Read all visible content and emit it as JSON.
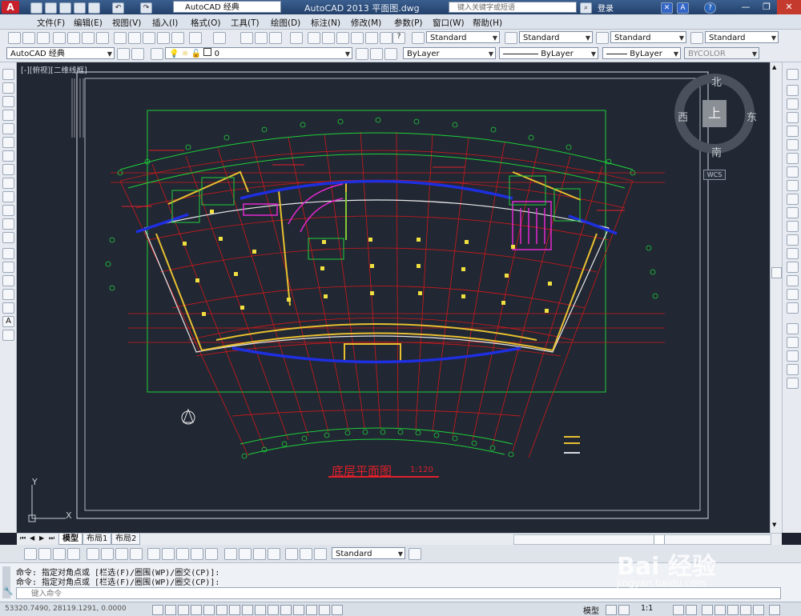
{
  "titlebar": {
    "workspace": "AutoCAD 经典",
    "app_title": "AutoCAD 2013    平面图.dwg",
    "search_placeholder": "键入关键字或短语",
    "login": "登录"
  },
  "menu": [
    "文件(F)",
    "编辑(E)",
    "视图(V)",
    "插入(I)",
    "格式(O)",
    "工具(T)",
    "绘图(D)",
    "标注(N)",
    "修改(M)",
    "参数(P)",
    "窗口(W)",
    "帮助(H)"
  ],
  "styles": {
    "text_style": "Standard",
    "dim_style": "Standard",
    "table_style": "Standard",
    "mleader_style": "Standard"
  },
  "layers": {
    "workspace": "AutoCAD 经典",
    "current_layer": "0",
    "color": "ByLayer",
    "linetype": "ByLayer",
    "lineweight": "ByLayer",
    "plotstyle": "BYCOLOR"
  },
  "viewport_label": "[-][俯视][二维线框]",
  "viewcube": {
    "north": "北",
    "south": "南",
    "west": "西",
    "east": "东",
    "top": "上",
    "wcs": "WCS"
  },
  "drawing": {
    "title": "底层平面图",
    "scale": "1:120"
  },
  "ucs": {
    "x": "X",
    "y": "Y"
  },
  "layout_tabs": [
    "模型",
    "布局1",
    "布局2"
  ],
  "dim_style_combo": "Standard",
  "command_history": [
    "命令: 指定对角点或 [栏选(F)/圈围(WP)/圈交(CP)]:",
    "命令: 指定对角点或 [栏选(F)/圈围(WP)/圈交(CP)]:"
  ],
  "command_placeholder": "键入命令",
  "status": {
    "coords": "53320.7490, 28119.1291, 0.0000",
    "model": "模型",
    "annotation_scale": "1:1"
  },
  "watermark": {
    "brand": "Bai 经验",
    "url": "jingyan.baidu.com"
  },
  "colors": {
    "canvas_bg": "#212733",
    "grid_red": "#d01a1a",
    "wall_green": "#1fd13a",
    "wall_yellow": "#e8c030",
    "window_blue": "#1e2fe0",
    "stairs_magenta": "#e22ad0",
    "title_red": "#e0202a"
  }
}
